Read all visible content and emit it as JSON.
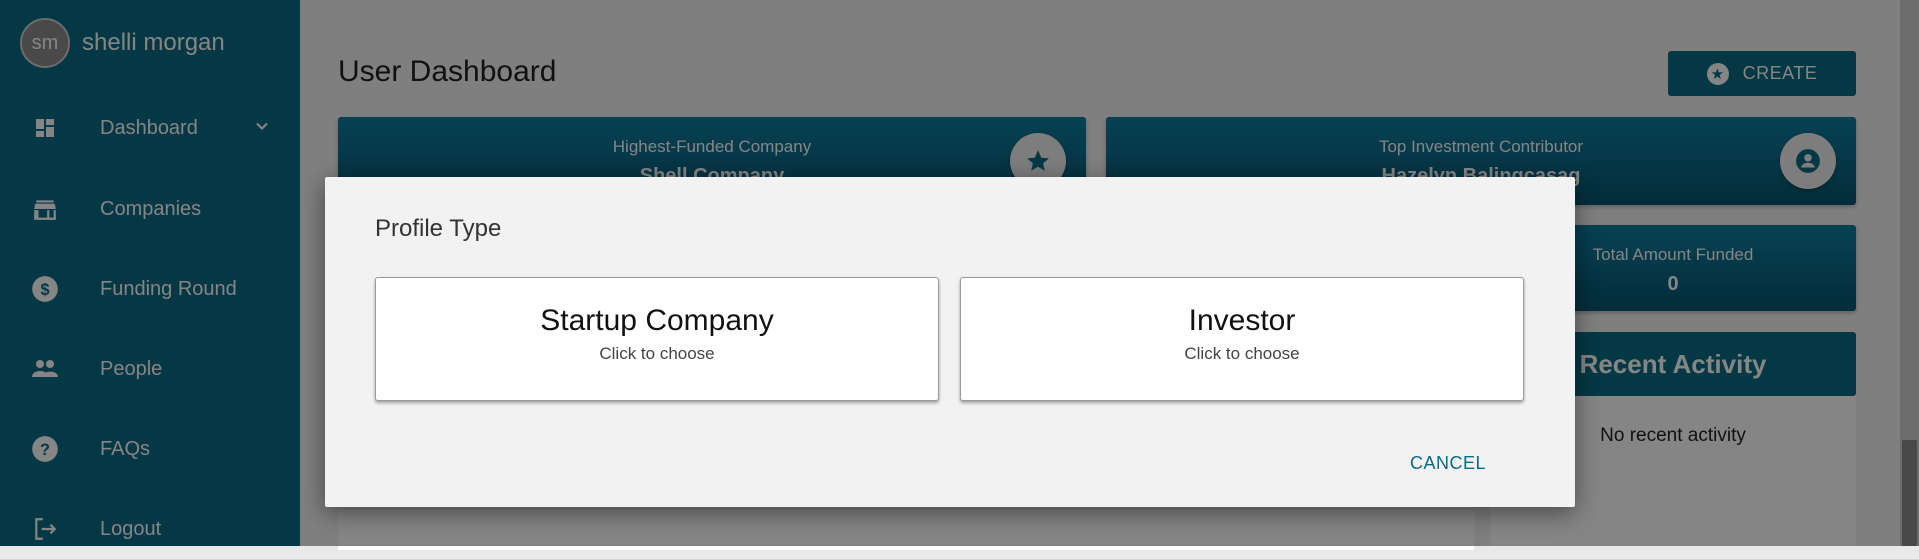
{
  "sidebar": {
    "avatar_initials": "sm",
    "username": "shelli morgan",
    "items": [
      {
        "label": "Dashboard",
        "icon": "dashboard-icon"
      },
      {
        "label": "Companies",
        "icon": "store-icon"
      },
      {
        "label": "Funding Round",
        "icon": "dollar-icon"
      },
      {
        "label": "People",
        "icon": "people-icon"
      },
      {
        "label": "FAQs",
        "icon": "help-icon"
      },
      {
        "label": "Logout",
        "icon": "logout-icon"
      }
    ]
  },
  "main": {
    "title": "User Dashboard",
    "create_label": "CREATE",
    "cards": {
      "highest_funded": {
        "label": "Highest-Funded Company",
        "value": "Shell Company"
      },
      "top_contributor": {
        "label": "Top Investment Contributor",
        "value": "Hazelyn Balingcasag"
      },
      "total_funded": {
        "label": "Total Amount Funded",
        "value": "0"
      }
    },
    "activity": {
      "title": "Recent Activity",
      "text": "No recent activity"
    }
  },
  "dialog": {
    "title": "Profile Type",
    "options": [
      {
        "title": "Startup Company",
        "subtitle": "Click to choose"
      },
      {
        "title": "Investor",
        "subtitle": "Click to choose"
      }
    ],
    "cancel_label": "CANCEL"
  },
  "colors": {
    "primary": "#0b6b85",
    "overlay": "rgba(0,0,0,0.48)"
  }
}
